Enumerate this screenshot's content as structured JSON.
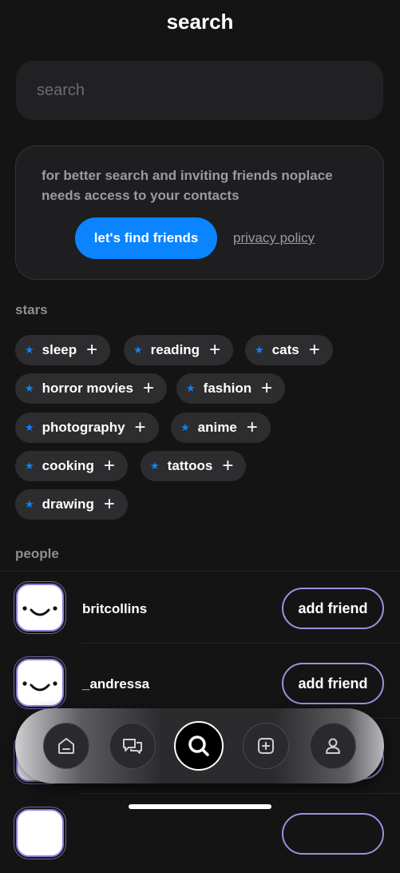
{
  "header": {
    "title": "search"
  },
  "search": {
    "placeholder": "search"
  },
  "contacts_card": {
    "message": "for better search and inviting friends noplace needs access to your contacts",
    "cta_label": "let's find friends",
    "privacy_label": "privacy policy"
  },
  "stars": {
    "heading": "stars",
    "items": [
      {
        "label": "sleep"
      },
      {
        "label": "reading"
      },
      {
        "label": "cats"
      },
      {
        "label": "horror movies"
      },
      {
        "label": "fashion"
      },
      {
        "label": "photography"
      },
      {
        "label": "anime"
      },
      {
        "label": "cooking"
      },
      {
        "label": "tattoos"
      },
      {
        "label": "drawing"
      }
    ]
  },
  "people": {
    "heading": "people",
    "add_label": "add friend",
    "items": [
      {
        "username": "britcollins"
      },
      {
        "username": "_andressa"
      }
    ]
  },
  "tabbar": {
    "items": [
      {
        "icon": "home-icon"
      },
      {
        "icon": "messages-icon"
      },
      {
        "icon": "search-icon",
        "active": true
      },
      {
        "icon": "add-post-icon"
      },
      {
        "icon": "profile-icon"
      }
    ]
  },
  "colors": {
    "accent": "#0a84ff",
    "background": "#141414",
    "outline": "#9d8fe0"
  }
}
